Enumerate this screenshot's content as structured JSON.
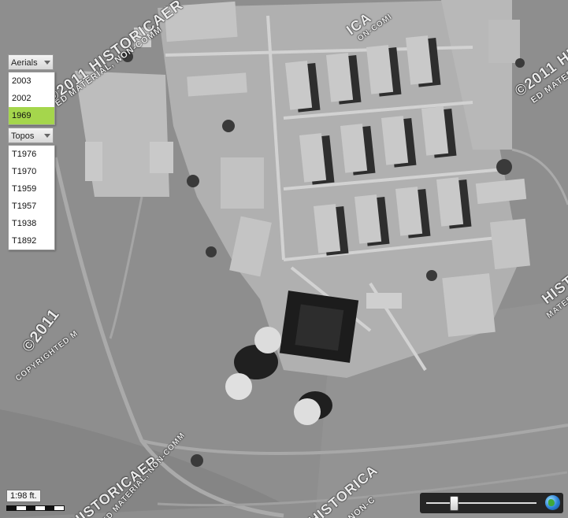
{
  "aerials": {
    "header": "Aerials",
    "items": [
      {
        "label": "2003",
        "active": false
      },
      {
        "label": "2002",
        "active": false
      },
      {
        "label": "1969",
        "active": true
      }
    ]
  },
  "topos": {
    "header": "Topos",
    "items": [
      {
        "label": "T1976"
      },
      {
        "label": "T1970"
      },
      {
        "label": "T1959"
      },
      {
        "label": "T1957"
      },
      {
        "label": "T1938"
      },
      {
        "label": "T1892"
      }
    ]
  },
  "scale": {
    "label": "1:98 ft."
  },
  "zoom": {
    "level_fraction": 0.25,
    "globe_icon": "globe-icon"
  },
  "watermarks": [
    "©2011 HISTORICAER",
    "ED MATERIAL, NON-COMM",
    "ICA",
    "ON-COMI",
    "©2011 HISTORIC",
    "ED MATERIAL, NON",
    "©2011",
    "COPYRIGHTED M",
    "HISTORICAER",
    "ED MATERIAL, NON-COMM",
    "HISTORICA",
    "NON-C",
    "HISTORIC",
    "MATERIAL, NON"
  ],
  "colors": {
    "active_item": "#a5d64c"
  }
}
